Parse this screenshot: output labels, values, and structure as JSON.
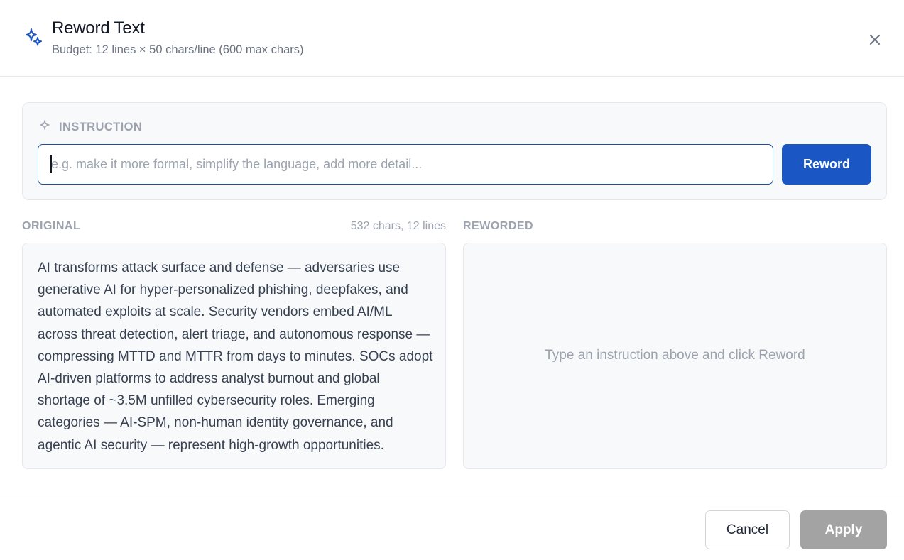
{
  "dialog": {
    "title": "Reword Text",
    "subtitle": "Budget: 12 lines × 50 chars/line (600 max chars)",
    "header_icon": "sparkles-icon",
    "close_icon": "close-icon",
    "accent_color": "#1a56c4"
  },
  "instruction": {
    "label": "INSTRUCTION",
    "icon": "sparkle-icon",
    "value": "",
    "placeholder": "e.g. make it more formal, simplify the language, add more detail...",
    "button_label": "Reword"
  },
  "original": {
    "label": "ORIGINAL",
    "meta": "532 chars, 12 lines",
    "text": "AI transforms attack surface and defense — adversaries use generative AI for hyper-personalized phishing, deepfakes, and automated exploits at scale. Security vendors embed AI/ML across threat detection, alert triage, and autonomous response — compressing MTTD and MTTR from days to minutes. SOCs adopt AI-driven platforms to address analyst burnout and global shortage of ~3.5M unfilled cybersecurity roles. Emerging categories — AI-SPM, non-human identity governance, and agentic AI security — represent high-growth opportunities."
  },
  "reworded": {
    "label": "REWORDED",
    "empty_hint": "Type an instruction above and click Reword"
  },
  "footer": {
    "cancel_label": "Cancel",
    "apply_label": "Apply",
    "apply_disabled_color": "#a3a3a3"
  }
}
